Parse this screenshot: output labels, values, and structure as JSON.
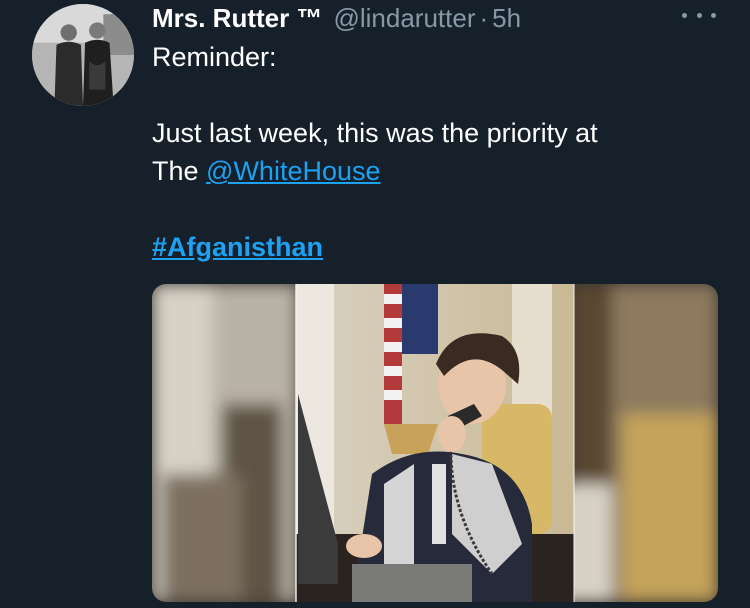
{
  "tweet": {
    "author_name": "Mrs. Rutter ™",
    "handle": "@lindarutter",
    "separator": "·",
    "time": "5h",
    "text_line1": "Reminder:",
    "text_line2a": "Just last week, this was the priority at",
    "text_line2b": "The ",
    "mention": "@WhiteHouse",
    "hashtag": "#Afganisthan"
  },
  "icons": {
    "more": "more-dots-icon"
  },
  "colors": {
    "background": "#15202b",
    "secondary_text": "#8899a6",
    "link": "#1da1f2"
  }
}
